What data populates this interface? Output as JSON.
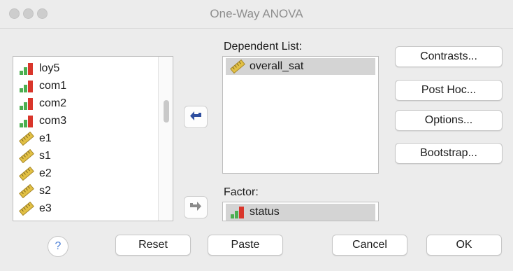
{
  "window": {
    "title": "One-Way ANOVA"
  },
  "variables": [
    {
      "name": "loy5",
      "icon": "scale-bar-icon"
    },
    {
      "name": "com1",
      "icon": "scale-bar-icon"
    },
    {
      "name": "com2",
      "icon": "scale-bar-icon"
    },
    {
      "name": "com3",
      "icon": "scale-bar-icon"
    },
    {
      "name": "e1",
      "icon": "ruler-icon"
    },
    {
      "name": "s1",
      "icon": "ruler-icon"
    },
    {
      "name": "e2",
      "icon": "ruler-icon"
    },
    {
      "name": "s2",
      "icon": "ruler-icon"
    },
    {
      "name": "e3",
      "icon": "ruler-icon"
    }
  ],
  "dependent": {
    "label": "Dependent List:",
    "items": [
      "overall_sat"
    ]
  },
  "factor": {
    "label": "Factor:",
    "value": "status"
  },
  "side_buttons": {
    "contrasts": "Contrasts...",
    "posthoc": "Post Hoc...",
    "options": "Options...",
    "bootstrap": "Bootstrap..."
  },
  "bottom_buttons": {
    "help": "?",
    "reset": "Reset",
    "paste": "Paste",
    "cancel": "Cancel",
    "ok": "OK"
  },
  "colors": {
    "bar_red": "#d9362b",
    "bar_green": "#4caf50",
    "ruler_yellow": "#e2c044",
    "arrow_blue": "#2f4f9f"
  }
}
